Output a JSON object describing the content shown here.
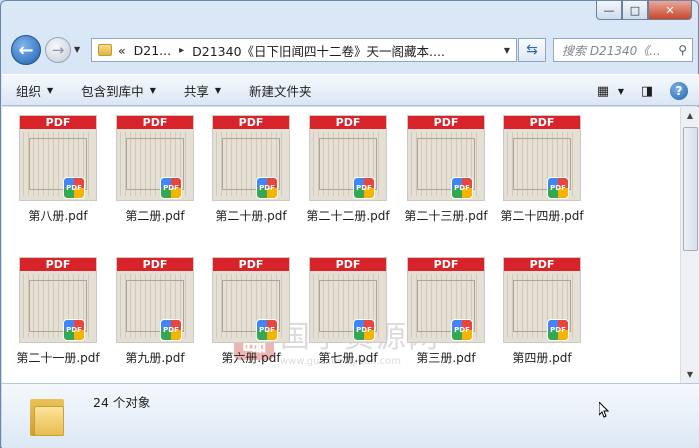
{
  "window": {
    "caption_buttons": {
      "minimize": "—",
      "maximize": "□",
      "close": "✕"
    }
  },
  "nav": {
    "breadcrumb_prefix": "«",
    "crumb1": "D21...",
    "crumb_sep": "▸",
    "crumb2": "D21340《日下旧闻四十二卷》天一阁藏本....",
    "search_placeholder": "搜索 D21340《..."
  },
  "toolbar": {
    "organize": "组织",
    "include_library": "包含到库中",
    "share": "共享",
    "new_folder": "新建文件夹"
  },
  "files": [
    {
      "name": "第八册.pdf"
    },
    {
      "name": "第二册.pdf"
    },
    {
      "name": "第二十册.pdf"
    },
    {
      "name": "第二十二册.pdf"
    },
    {
      "name": "第二十三册.pdf"
    },
    {
      "name": "第二十四册.pdf"
    },
    {
      "name": "第二十一册.pdf"
    },
    {
      "name": "第九册.pdf"
    },
    {
      "name": "第六册.pdf"
    },
    {
      "name": "第七册.pdf"
    },
    {
      "name": "第三册.pdf"
    },
    {
      "name": "第四册.pdf"
    }
  ],
  "thumb": {
    "band_label": "PDF",
    "badge_label": "PDF"
  },
  "watermark": {
    "seal": "臨",
    "text": "国学资源网",
    "url": "www.guoxueziyuan.com"
  },
  "status": {
    "count": "24 个对象"
  }
}
